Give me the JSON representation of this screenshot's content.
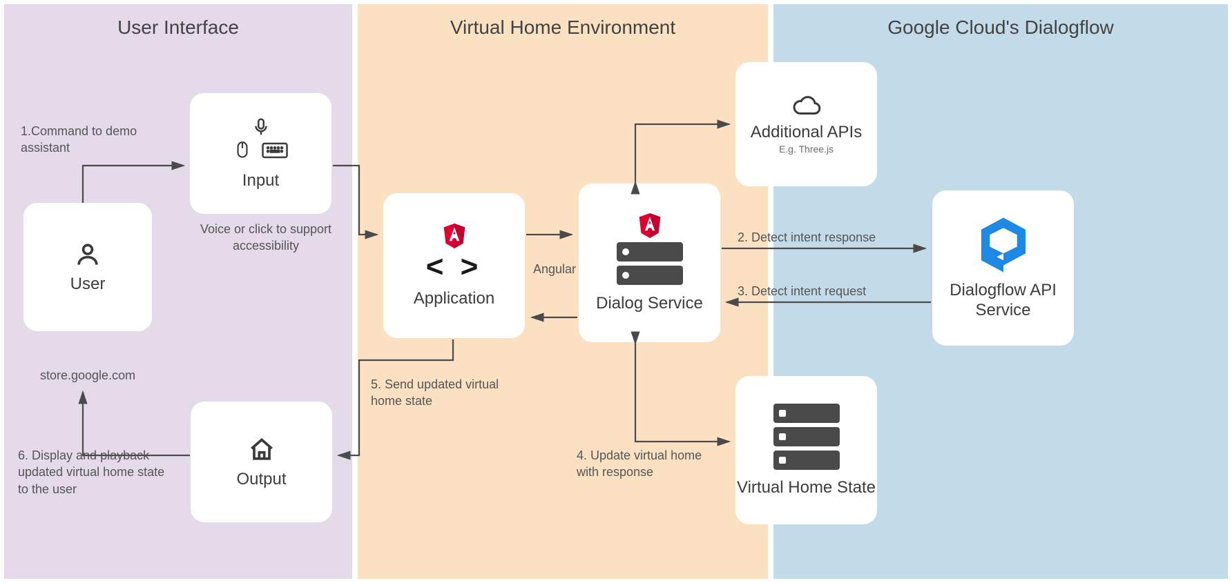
{
  "zones": {
    "ui": {
      "title": "User Interface"
    },
    "vhe": {
      "title": "Virtual Home Environment"
    },
    "gdf": {
      "title": "Google Cloud's Dialogflow"
    }
  },
  "boxes": {
    "user": {
      "title": "User"
    },
    "input": {
      "title": "Input",
      "caption": "Voice or click to support accessibility"
    },
    "output": {
      "title": "Output"
    },
    "application": {
      "title": "Application"
    },
    "dialog_service": {
      "title": "Dialog Service"
    },
    "additional_apis": {
      "title": "Additional APIs",
      "subtitle": "E.g. Three.js"
    },
    "virtual_home_state": {
      "title": "Virtual Home State"
    },
    "df_api": {
      "title": "Dialogflow API Service"
    }
  },
  "annotations": {
    "step1": "1.Command to demo assistant",
    "angular": "Angular",
    "step2": "2. Detect intent response",
    "step3": "3. Detect intent request",
    "step4": "4. Update virtual home with response",
    "step5": "5. Send updated virtual home state",
    "step6_header": "store.google.com",
    "step6": "6. Display and playback updated virtual home state to the user"
  }
}
